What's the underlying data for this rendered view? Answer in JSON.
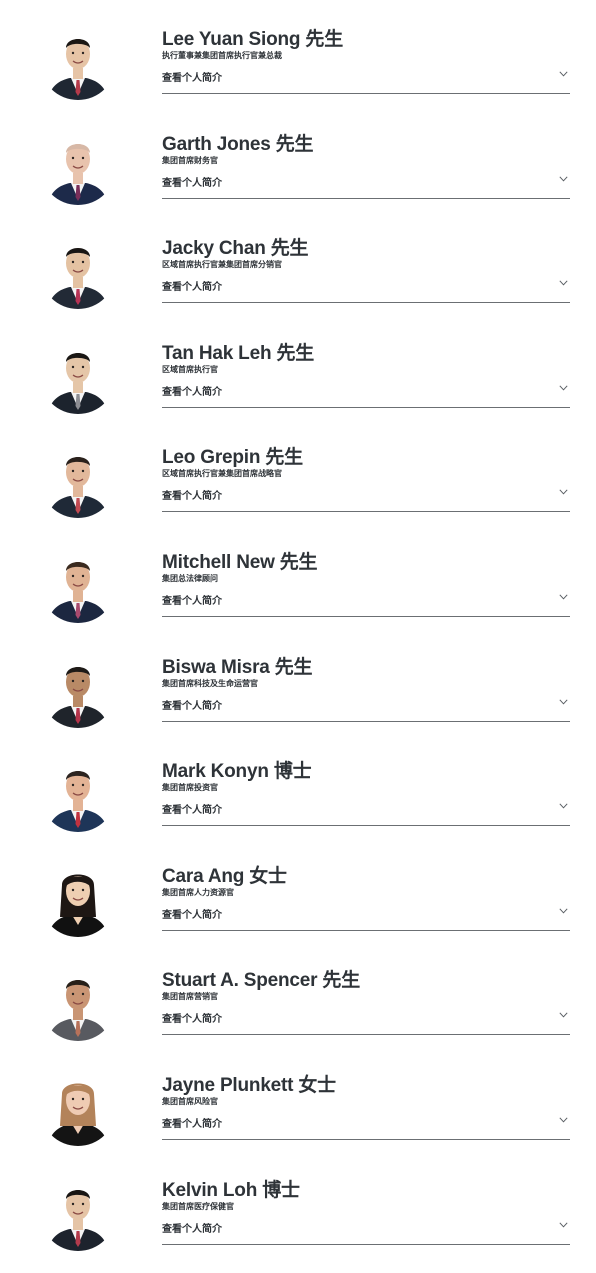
{
  "toggle_label": "查看个人简介",
  "executives": [
    {
      "name": "Lee Yuan Siong 先生",
      "title": "执行董事兼集团首席执行官兼总裁",
      "suit": "#1f2733",
      "tie": "#b53a4a",
      "hair": "#1b1714",
      "skin": "#e6c4a6",
      "bg": "#ffffff"
    },
    {
      "name": "Garth Jones 先生",
      "title": "集团首席财务官",
      "suit": "#1d2a4a",
      "tie": "#7a2f5a",
      "hair": "#d7b8a6",
      "skin": "#e8c3ad",
      "bg": "#ffffff"
    },
    {
      "name": "Jacky Chan 先生",
      "title": "区域首席执行官兼集团首席分销官",
      "suit": "#222a36",
      "tie": "#b73355",
      "hair": "#181513",
      "skin": "#e4c2a2",
      "bg": "#ffffff"
    },
    {
      "name": "Tan Hak Leh 先生",
      "title": "区域首席执行官",
      "suit": "#1c232d",
      "tie": "#8c8d92",
      "hair": "#1a1714",
      "skin": "#e5c6a8",
      "bg": "#ffffff"
    },
    {
      "name": "Leo Grepin 先生",
      "title": "区域首席执行官兼集团首席战略官",
      "suit": "#1f2937",
      "tie": "#c24a52",
      "hair": "#2a211c",
      "skin": "#e2b89b",
      "bg": "#ffffff"
    },
    {
      "name": "Mitchell New 先生",
      "title": "集团总法律顾问",
      "suit": "#1c2740",
      "tie": "#a94a6e",
      "hair": "#3a2a1f",
      "skin": "#e0b394",
      "bg": "#ffffff"
    },
    {
      "name": "Biswa Misra 先生",
      "title": "集团首席科技及生命运营官",
      "suit": "#1f242b",
      "tie": "#b5344b",
      "hair": "#1e1a17",
      "skin": "#b98a66",
      "bg": "#ffffff"
    },
    {
      "name": "Mark Konyn 博士",
      "title": "集团首席投资官",
      "suit": "#1e3558",
      "tie": "#c2323f",
      "hair": "#2b231f",
      "skin": "#e3b395",
      "bg": "#ffffff"
    },
    {
      "name": "Cara Ang 女士",
      "title": "集团首席人力资源官",
      "suit": "#111111",
      "tie": "#111111",
      "hair": "#1e1714",
      "skin": "#efcfb2",
      "bg": "#ffffff"
    },
    {
      "name": "Stuart A. Spencer 先生",
      "title": "集团首席营销官",
      "suit": "#585a60",
      "tie": "#b8725a",
      "hair": "#272019",
      "skin": "#c99574",
      "bg": "#ffffff"
    },
    {
      "name": "Jayne Plunkett 女士",
      "title": "集团首席风险官",
      "suit": "#141414",
      "tie": "#141414",
      "hair": "#b3835a",
      "skin": "#efcbb3",
      "bg": "#ffffff"
    },
    {
      "name": "Kelvin Loh 博士",
      "title": "集团首席医疗保健官",
      "suit": "#1d232d",
      "tie": "#b33b4c",
      "hair": "#181513",
      "skin": "#e5c4a6",
      "bg": "#ffffff"
    }
  ]
}
